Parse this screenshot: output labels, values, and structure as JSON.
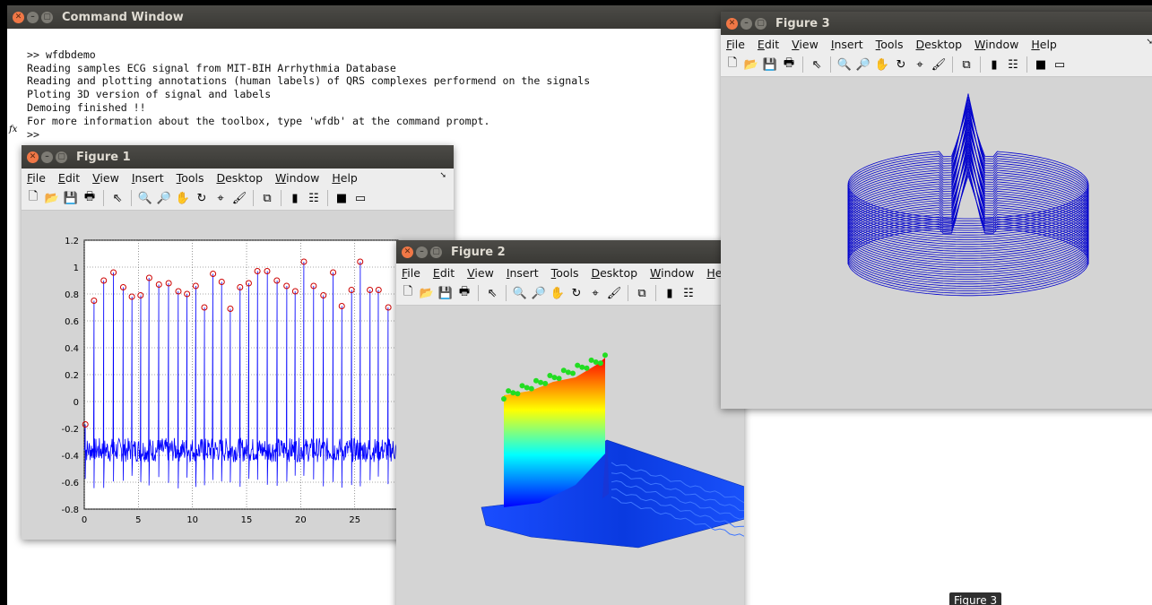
{
  "command_window": {
    "title": "Command Window",
    "lines": [
      ">> wfdbdemo",
      "Reading samples ECG signal from MIT-BIH Arrhythmia Database",
      "Reading and plotting annotations (human labels) of QRS complexes performend on the signals",
      "Ploting 3D version of signal and labels",
      "Demoing finished !!",
      "For more information about the toolbox, type 'wfdb' at the command prompt.",
      ">>"
    ],
    "fx_label": "fx"
  },
  "menu_items": [
    "File",
    "Edit",
    "View",
    "Insert",
    "Tools",
    "Desktop",
    "Window",
    "Help"
  ],
  "figure1": {
    "title": "Figure 1",
    "chart_data": {
      "type": "line",
      "xlim": [
        0,
        29
      ],
      "ylim": [
        -0.8,
        1.2
      ],
      "xticks": [
        "0",
        "5",
        "10",
        "15",
        "20",
        "25"
      ],
      "yticks": [
        "-0.8",
        "-0.6",
        "-0.4",
        "-0.2",
        "0",
        "0.2",
        "0.4",
        "0.6",
        "0.8",
        "1",
        "1.2"
      ],
      "grid": true,
      "series": [
        {
          "values": [
            -0.36,
            0.95,
            -0.34
          ],
          "color": "#0000ff"
        }
      ],
      "annotations": {
        "x": [
          0.1,
          0.9,
          1.8,
          2.7,
          3.6,
          4.4,
          5.2,
          6.0,
          6.9,
          7.8,
          8.7,
          9.5,
          10.3,
          11.1,
          11.9,
          12.7,
          13.5,
          14.4,
          15.2,
          16.0,
          16.9,
          17.8,
          18.7,
          19.5,
          20.3,
          21.2,
          22.1,
          23.0,
          23.8,
          24.7,
          25.5,
          26.4,
          27.2,
          28.1
        ],
        "y": [
          -0.17,
          0.75,
          0.9,
          0.96,
          0.85,
          0.78,
          0.79,
          0.92,
          0.87,
          0.88,
          0.82,
          0.8,
          0.86,
          0.7,
          0.95,
          0.89,
          0.69,
          0.85,
          0.88,
          0.97,
          0.97,
          0.9,
          0.86,
          0.82,
          1.04,
          0.86,
          0.79,
          0.96,
          0.71,
          0.83,
          1.04,
          0.83,
          0.83,
          0.7
        ],
        "color": "#cc0000"
      }
    }
  },
  "figure2": {
    "title": "Figure 2",
    "chart_data": {
      "type": "area",
      "description_only": false,
      "colormap": [
        "#0000ff",
        "#00ffff",
        "#ffff00",
        "#ff0000"
      ],
      "marker_color": "#22dd22"
    }
  },
  "figure3": {
    "title": "Figure 3",
    "chart_data": {
      "type": "line",
      "color": "#0000cc"
    }
  },
  "taskbar_tooltip": "Figure 3"
}
